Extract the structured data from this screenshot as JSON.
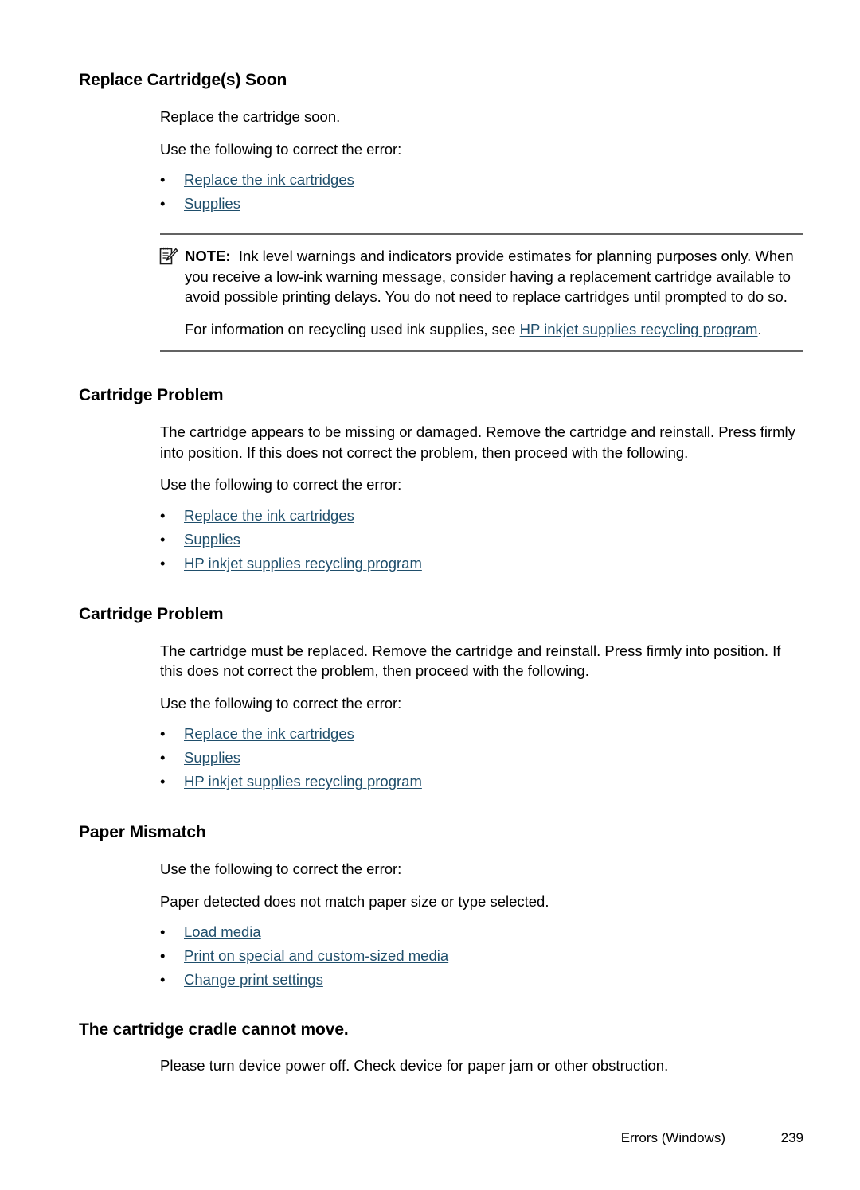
{
  "colors": {
    "link": "#1f4e6b",
    "rule": "#636363",
    "text": "#000000",
    "background": "#ffffff"
  },
  "sections": [
    {
      "heading": "Replace Cartridge(s) Soon",
      "paragraphs": [
        "Replace the cartridge soon.",
        "Use the following to correct the error:"
      ],
      "links": [
        "Replace the ink cartridges",
        "Supplies"
      ]
    },
    {
      "heading": "Cartridge Problem",
      "paragraphs": [
        "The cartridge appears to be missing or damaged. Remove the cartridge and reinstall. Press firmly into position. If this does not correct the problem, then proceed with the following.",
        "Use the following to correct the error:"
      ],
      "links": [
        "Replace the ink cartridges",
        "Supplies",
        "HP inkjet supplies recycling program"
      ]
    },
    {
      "heading": "Cartridge Problem",
      "paragraphs": [
        "The cartridge must be replaced. Remove the cartridge and reinstall. Press firmly into position. If this does not correct the problem, then proceed with the following.",
        "Use the following to correct the error:"
      ],
      "links": [
        "Replace the ink cartridges",
        "Supplies",
        "HP inkjet supplies recycling program"
      ]
    },
    {
      "heading": "Paper Mismatch",
      "paragraphs": [
        "Use the following to correct the error:",
        "Paper detected does not match paper size or type selected."
      ],
      "links": [
        "Load media",
        "Print on special and custom-sized media",
        "Change print settings"
      ]
    },
    {
      "heading": "The cartridge cradle cannot move.",
      "paragraphs": [
        "Please turn device power off. Check device for paper jam or other obstruction."
      ],
      "links": []
    }
  ],
  "note": {
    "icon": "note-pad-pencil-icon",
    "label": "NOTE:",
    "body": "Ink level warnings and indicators provide estimates for planning purposes only. When you receive a low-ink warning message, consider having a replacement cartridge available to avoid possible printing delays. You do not need to replace cartridges until prompted to do so.",
    "second_prefix": "For information on recycling used ink supplies, see ",
    "second_link": "HP inkjet supplies recycling program",
    "second_suffix": "."
  },
  "bullet": "•",
  "footer": {
    "chapter": "Errors (Windows)",
    "page_number": "239"
  }
}
